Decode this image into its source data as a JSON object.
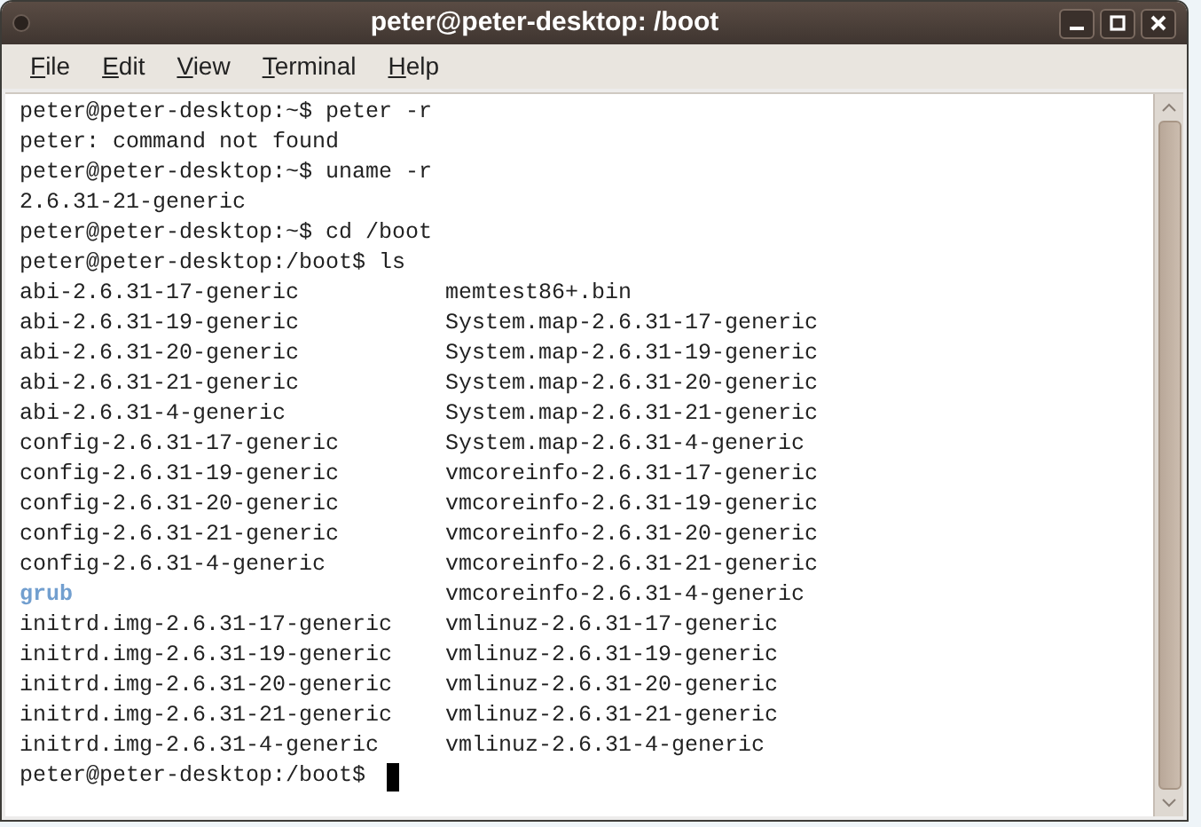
{
  "window": {
    "title": "peter@peter-desktop: /boot"
  },
  "menu": [
    "File",
    "Edit",
    "View",
    "Terminal",
    "Help"
  ],
  "terminal": {
    "lines": [
      {
        "kind": "text",
        "text": "peter@peter-desktop:~$ peter -r"
      },
      {
        "kind": "text",
        "text": "peter: command not found"
      },
      {
        "kind": "text",
        "text": "peter@peter-desktop:~$ uname -r"
      },
      {
        "kind": "text",
        "text": "2.6.31-21-generic"
      },
      {
        "kind": "text",
        "text": "peter@peter-desktop:~$ cd /boot"
      },
      {
        "kind": "text",
        "text": "peter@peter-desktop:/boot$ ls"
      },
      {
        "kind": "ls_row",
        "cells": [
          {
            "text": "abi-2.6.31-17-generic",
            "kind": "file"
          },
          {
            "text": "memtest86+.bin",
            "kind": "file"
          }
        ]
      },
      {
        "kind": "ls_row",
        "cells": [
          {
            "text": "abi-2.6.31-19-generic",
            "kind": "file"
          },
          {
            "text": "System.map-2.6.31-17-generic",
            "kind": "file"
          }
        ]
      },
      {
        "kind": "ls_row",
        "cells": [
          {
            "text": "abi-2.6.31-20-generic",
            "kind": "file"
          },
          {
            "text": "System.map-2.6.31-19-generic",
            "kind": "file"
          }
        ]
      },
      {
        "kind": "ls_row",
        "cells": [
          {
            "text": "abi-2.6.31-21-generic",
            "kind": "file"
          },
          {
            "text": "System.map-2.6.31-20-generic",
            "kind": "file"
          }
        ]
      },
      {
        "kind": "ls_row",
        "cells": [
          {
            "text": "abi-2.6.31-4-generic",
            "kind": "file"
          },
          {
            "text": "System.map-2.6.31-21-generic",
            "kind": "file"
          }
        ]
      },
      {
        "kind": "ls_row",
        "cells": [
          {
            "text": "config-2.6.31-17-generic",
            "kind": "file"
          },
          {
            "text": "System.map-2.6.31-4-generic",
            "kind": "file"
          }
        ]
      },
      {
        "kind": "ls_row",
        "cells": [
          {
            "text": "config-2.6.31-19-generic",
            "kind": "file"
          },
          {
            "text": "vmcoreinfo-2.6.31-17-generic",
            "kind": "file"
          }
        ]
      },
      {
        "kind": "ls_row",
        "cells": [
          {
            "text": "config-2.6.31-20-generic",
            "kind": "file"
          },
          {
            "text": "vmcoreinfo-2.6.31-19-generic",
            "kind": "file"
          }
        ]
      },
      {
        "kind": "ls_row",
        "cells": [
          {
            "text": "config-2.6.31-21-generic",
            "kind": "file"
          },
          {
            "text": "vmcoreinfo-2.6.31-20-generic",
            "kind": "file"
          }
        ]
      },
      {
        "kind": "ls_row",
        "cells": [
          {
            "text": "config-2.6.31-4-generic",
            "kind": "file"
          },
          {
            "text": "vmcoreinfo-2.6.31-21-generic",
            "kind": "file"
          }
        ]
      },
      {
        "kind": "ls_row",
        "cells": [
          {
            "text": "grub",
            "kind": "directory"
          },
          {
            "text": "vmcoreinfo-2.6.31-4-generic",
            "kind": "file"
          }
        ]
      },
      {
        "kind": "ls_row",
        "cells": [
          {
            "text": "initrd.img-2.6.31-17-generic",
            "kind": "file"
          },
          {
            "text": "vmlinuz-2.6.31-17-generic",
            "kind": "file"
          }
        ]
      },
      {
        "kind": "ls_row",
        "cells": [
          {
            "text": "initrd.img-2.6.31-19-generic",
            "kind": "file"
          },
          {
            "text": "vmlinuz-2.6.31-19-generic",
            "kind": "file"
          }
        ]
      },
      {
        "kind": "ls_row",
        "cells": [
          {
            "text": "initrd.img-2.6.31-20-generic",
            "kind": "file"
          },
          {
            "text": "vmlinuz-2.6.31-20-generic",
            "kind": "file"
          }
        ]
      },
      {
        "kind": "ls_row",
        "cells": [
          {
            "text": "initrd.img-2.6.31-21-generic",
            "kind": "file"
          },
          {
            "text": "vmlinuz-2.6.31-21-generic",
            "kind": "file"
          }
        ]
      },
      {
        "kind": "ls_row",
        "cells": [
          {
            "text": "initrd.img-2.6.31-4-generic",
            "kind": "file"
          },
          {
            "text": "vmlinuz-2.6.31-4-generic",
            "kind": "file"
          }
        ]
      },
      {
        "kind": "prompt",
        "text": "peter@peter-desktop:/boot$"
      }
    ]
  }
}
